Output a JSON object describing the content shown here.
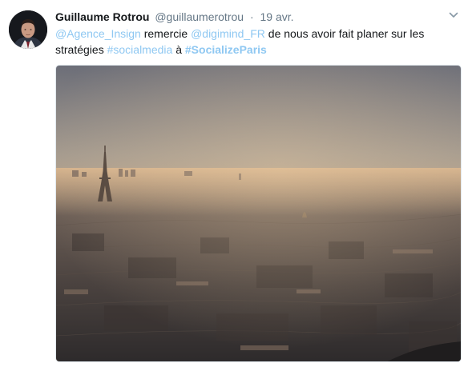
{
  "tweet": {
    "author_name": "Guillaume Rotrou",
    "handle": "@guillaumerotrou",
    "separator": "·",
    "timestamp": "19 avr.",
    "text": {
      "mention1": "@Agence_Insign",
      "word1": " remercie ",
      "mention2": "@digimind_FR",
      "word2": " de nous avoir fait planer sur les stratégies ",
      "hashtag1": "#socialmedia",
      "word3": " à ",
      "hashtag2": "#SocializeParis"
    },
    "icons": {
      "avatar": "profile-photo",
      "menu": "chevron-down-icon"
    },
    "media": {
      "description_icon": "photo"
    }
  },
  "colors": {
    "link": "#8fc8f2",
    "name": "#14171a",
    "meta": "#657786"
  }
}
